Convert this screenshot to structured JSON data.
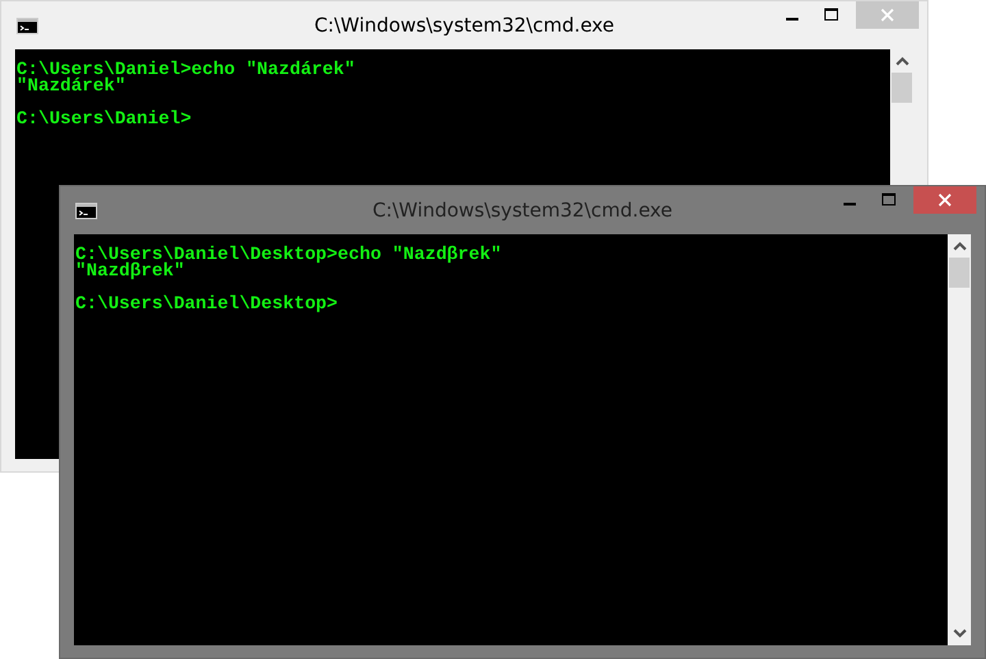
{
  "windows": [
    {
      "title": "C:\\Windows\\system32\\cmd.exe",
      "focused": false,
      "lines": [
        {
          "kind": "command",
          "text": "C:\\Users\\Daniel>echo \"Nazdárek\""
        },
        {
          "kind": "output",
          "text": "\"Nazdárek\""
        },
        {
          "kind": "prompt",
          "text": "C:\\Users\\Daniel>"
        }
      ]
    },
    {
      "title": "C:\\Windows\\system32\\cmd.exe",
      "focused": true,
      "lines": [
        {
          "kind": "command",
          "text": "C:\\Users\\Daniel\\Desktop>echo \"Nazdβrek\""
        },
        {
          "kind": "output",
          "text": "\"Nazdβrek\""
        },
        {
          "kind": "prompt",
          "text": "C:\\Users\\Daniel\\Desktop>"
        }
      ]
    }
  ]
}
